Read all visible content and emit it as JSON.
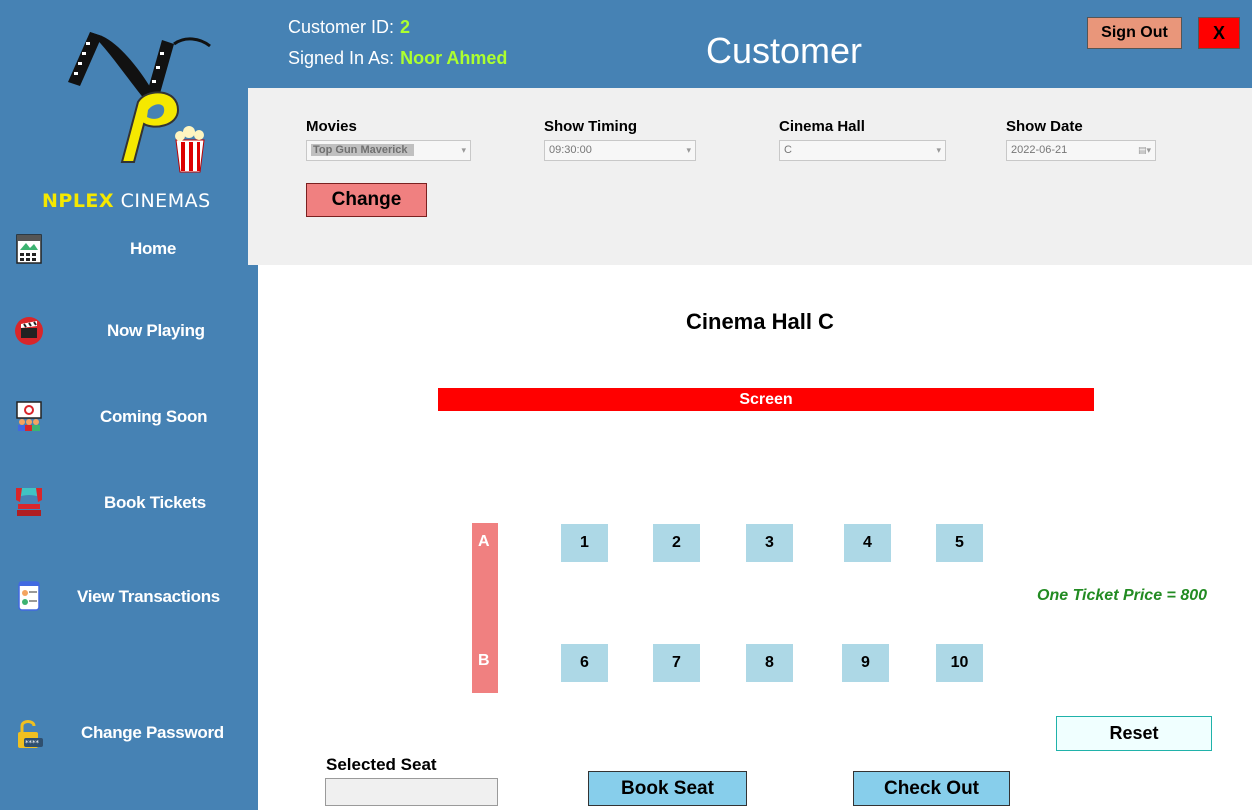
{
  "brand": {
    "hl": "NPLEX",
    "rest": " CINEMAS"
  },
  "sidebar": {
    "items": [
      {
        "label": "Home",
        "icon": "home-calendar-icon"
      },
      {
        "label": "Now Playing",
        "icon": "clapperboard-icon"
      },
      {
        "label": "Coming Soon",
        "icon": "audience-icon"
      },
      {
        "label": "Book Tickets",
        "icon": "theater-seats-icon"
      },
      {
        "label": "View Transactions",
        "icon": "transactions-icon"
      },
      {
        "label": "Change Password",
        "icon": "padlock-icon"
      }
    ]
  },
  "header": {
    "customer_id_label": "Customer ID:",
    "customer_id": "2",
    "signed_in_label": "Signed In As:",
    "signed_in_name": "Noor Ahmed",
    "title": "Customer",
    "sign_out": "Sign Out",
    "close": "X"
  },
  "filters": {
    "movies_label": "Movies",
    "movies_value": "Top Gun Maverick",
    "timing_label": "Show Timing",
    "timing_value": "09:30:00",
    "hall_label": "Cinema Hall",
    "hall_value": "C",
    "date_label": "Show Date",
    "date_value": "2022-06-21",
    "change": "Change"
  },
  "main": {
    "hall_title": "Cinema Hall C",
    "screen": "Screen",
    "row_a": "A",
    "row_b": "B",
    "seats": [
      "1",
      "2",
      "3",
      "4",
      "5",
      "6",
      "7",
      "8",
      "9",
      "10"
    ],
    "price": "One Ticket Price = 800",
    "reset": "Reset",
    "selected_label": "Selected Seat",
    "selected_value": "",
    "book": "Book Seat",
    "checkout": "Check Out"
  },
  "colors": {
    "sidebar_bg": "#4682b4",
    "panel_bg": "#f0f0f0",
    "highlight_green": "#adff2f",
    "seat_blue": "#add8e6",
    "button_blue": "#87ceeb",
    "salmon": "#f08080",
    "screen_red": "#ff0000",
    "price_green": "#228b22"
  }
}
